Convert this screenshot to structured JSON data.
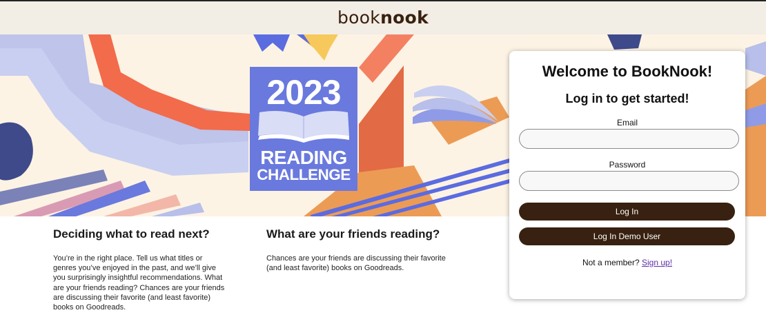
{
  "header": {
    "logo_light": "book",
    "logo_bold": "nook"
  },
  "banner": {
    "badge_year": "2023",
    "badge_line1": "READING",
    "badge_line2": "CHALLENGE",
    "colors": {
      "badge": "#6a79dd",
      "background": "#fdf3e4",
      "orange": "#f26b4b",
      "lavender": "#b7bfea"
    }
  },
  "sections": [
    {
      "heading": "Deciding what to read next?",
      "body": "You’re in the right place. Tell us what titles or genres you’ve enjoyed in the past, and we’ll give you surprisingly insightful recommendations. What are your friends reading? Chances are your friends are discussing their favorite (and least favorite) books on Goodreads."
    },
    {
      "heading": "What are your friends reading?",
      "body": "Chances are your friends are discussing their favorite (and least favorite) books on Goodreads."
    }
  ],
  "login": {
    "title": "Welcome to BookNook!",
    "subtitle": "Log in to get started!",
    "email_label": "Email",
    "email_value": "",
    "password_label": "Password",
    "password_value": "",
    "login_button": "Log In",
    "demo_button": "Log In Demo User",
    "signup_prompt": "Not a member?",
    "signup_link": "Sign up!"
  },
  "colors": {
    "brand": "#382110",
    "header_bg": "#f2ede5"
  }
}
